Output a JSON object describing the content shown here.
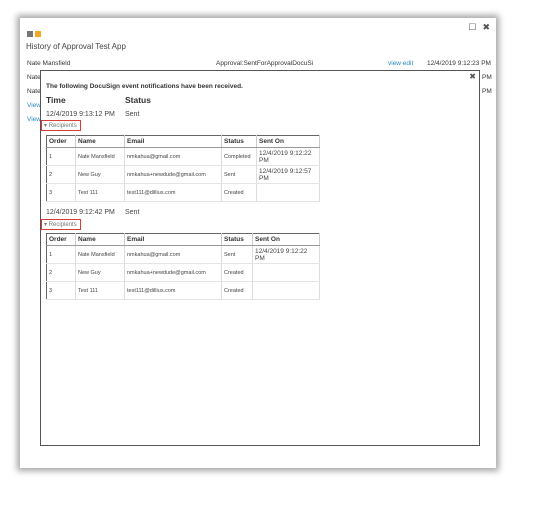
{
  "window": {
    "logo_colors": [
      "#777777",
      "#f5a623"
    ],
    "restore_icon": "restore-icon",
    "close_icon": "close-icon",
    "app_title": "History of Approval Test App"
  },
  "background": {
    "row1": {
      "name": "Nate Mansfield",
      "event": "Approval:SentForApprovalDocuSi",
      "link": "view edit",
      "time": "12/4/2019 9:12:23 PM"
    },
    "row2_name": "Nate",
    "row3_name": "Nate",
    "row4_link": "View",
    "row5_link": "View",
    "pm2": "PM",
    "pm3": "PM"
  },
  "modal": {
    "close": "✖",
    "heading": "The following DocuSign event notifications have been received.",
    "col_time": "Time",
    "col_status": "Status",
    "events": [
      {
        "time": "12/4/2019 9:13:12 PM",
        "status": "Sent",
        "recipients_label": "Recipients",
        "headers": [
          "Order",
          "Name",
          "Email",
          "Status",
          "Sent On"
        ],
        "rows": [
          [
            "1",
            "Nate Mansfield",
            "nmkahua@gmail.com",
            "Completed",
            "12/4/2019 9:12:22 PM"
          ],
          [
            "2",
            "New Guy",
            "nmkahua+newdude@gmail.com",
            "Sent",
            "12/4/2019 9:12:57 PM"
          ],
          [
            "3",
            "Test 111",
            "test111@dillius.com",
            "Created",
            ""
          ]
        ]
      },
      {
        "time": "12/4/2019 9:12:42 PM",
        "status": "Sent",
        "recipients_label": "Recipients",
        "headers": [
          "Order",
          "Name",
          "Email",
          "Status",
          "Sent On"
        ],
        "rows": [
          [
            "1",
            "Nate Mansfield",
            "nmkahua@gmail.com",
            "Sent",
            "12/4/2019 9:12:22 PM"
          ],
          [
            "2",
            "New Guy",
            "nmkahua+newdude@gmail.com",
            "Created",
            ""
          ],
          [
            "3",
            "Test 111",
            "test111@dillius.com",
            "Created",
            ""
          ]
        ]
      }
    ]
  }
}
